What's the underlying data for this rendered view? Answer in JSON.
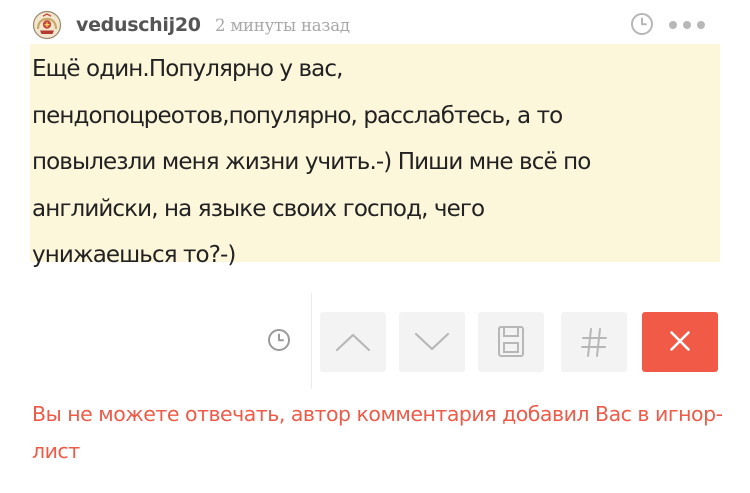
{
  "comment": {
    "author": "veduschij20",
    "time_ago": "2 минуты назад",
    "text": "Ещё один.Популярно у вас,\nпендопоцреотов,популярно, расслабтесь, а то\nповылезли меня жизни учить.-) Пиши мне всё по\nанглийски, на языке своих господ, чего\nунижаешься то?-)"
  },
  "header_icons": [
    "clock-icon",
    "more-icon"
  ],
  "actions": {
    "icons": [
      "clock-icon",
      "chevron-up-icon",
      "chevron-down-icon",
      "save-icon",
      "hash-icon",
      "close-icon"
    ]
  },
  "notice": {
    "text": "Вы не можете отвечать, автор комментария добавил Вас в игнор-лист"
  },
  "colors": {
    "comment_background": "#fcf6da",
    "button_background": "#f3f3f3",
    "close_button": "#f25a48",
    "notice_text": "#ee5b48",
    "username": "#555555",
    "timestamp": "#a8a8a8",
    "icon": "#b7b7b7"
  }
}
